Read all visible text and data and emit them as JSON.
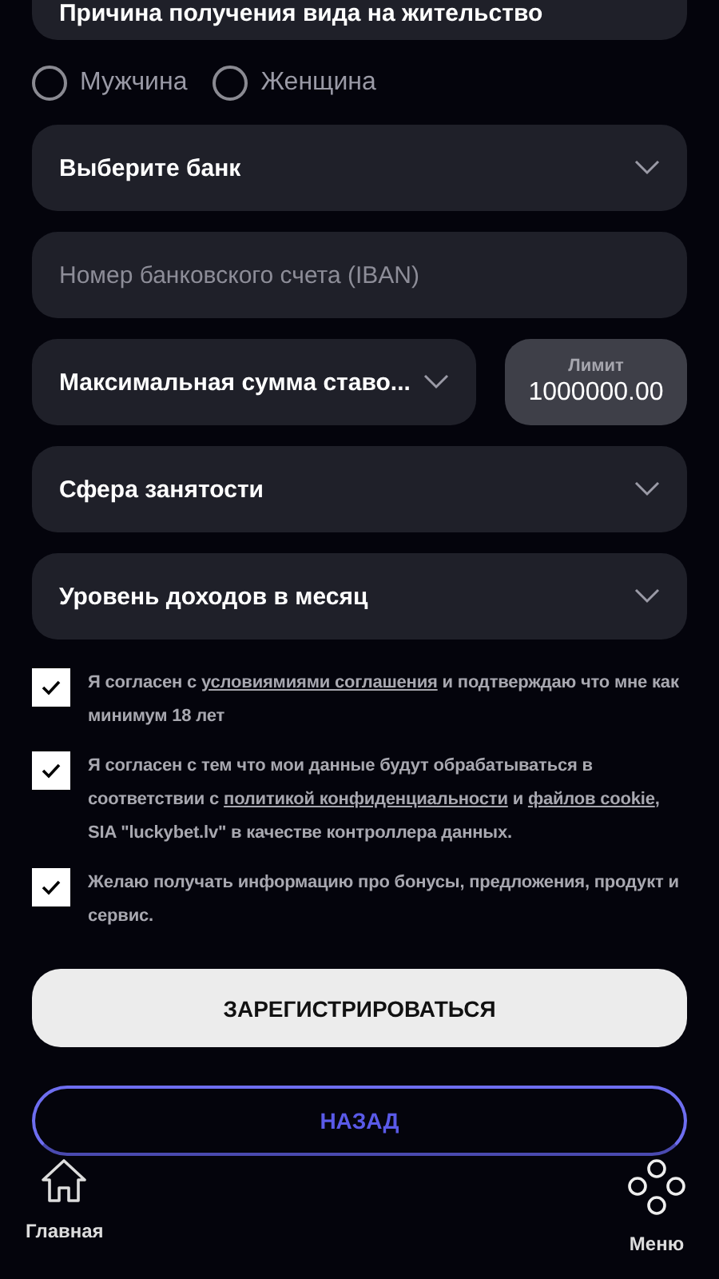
{
  "top_field": {
    "value": "Причина получения вида на жительство"
  },
  "gender": [
    {
      "label": "Мужчина",
      "selected": false
    },
    {
      "label": "Женщина",
      "selected": false
    }
  ],
  "fields": [
    {
      "kind": "select",
      "label": "Выберите банк"
    },
    {
      "kind": "input",
      "placeholder": "Номер банковского счета (IBAN)"
    },
    {
      "kind": "select_limit",
      "label": "Максимальная сумма ставо...",
      "limit_label": "Лимит",
      "limit_value": "1000000.00"
    },
    {
      "kind": "select",
      "label": "Сфера занятости"
    },
    {
      "kind": "select",
      "label": "Уровень доходов в месяц"
    }
  ],
  "consents": [
    {
      "parts": [
        {
          "kind": "text",
          "text": "Я согласен с "
        },
        {
          "kind": "link",
          "text": "условиямиями соглашения"
        },
        {
          "kind": "text",
          "text": " и подтверждаю что мне как минимум 18 лет"
        }
      ],
      "checked": true
    },
    {
      "parts": [
        {
          "kind": "text",
          "text": "Я согласен с тем что мои данные будут обрабатываться в соответствии с "
        },
        {
          "kind": "link",
          "text": "политикой конфиденциальности"
        },
        {
          "kind": "text",
          "text": " и "
        },
        {
          "kind": "link",
          "text": "файлов cookie"
        },
        {
          "kind": "text",
          "text": ", SIA \"luckybet.lv\" в качестве контроллера данных."
        }
      ],
      "checked": true
    },
    {
      "parts": [
        {
          "kind": "text",
          "text": "Желаю получать информацию про бонусы, предложения, продукт и сервис."
        }
      ],
      "checked": true
    }
  ],
  "register_button": "ЗАРЕГИСТРИРОВАТЬСЯ",
  "back_button": "НАЗАД",
  "nav": [
    {
      "kind": "home",
      "label": "Главная"
    },
    {
      "kind": "menu",
      "label": "Меню"
    }
  ]
}
